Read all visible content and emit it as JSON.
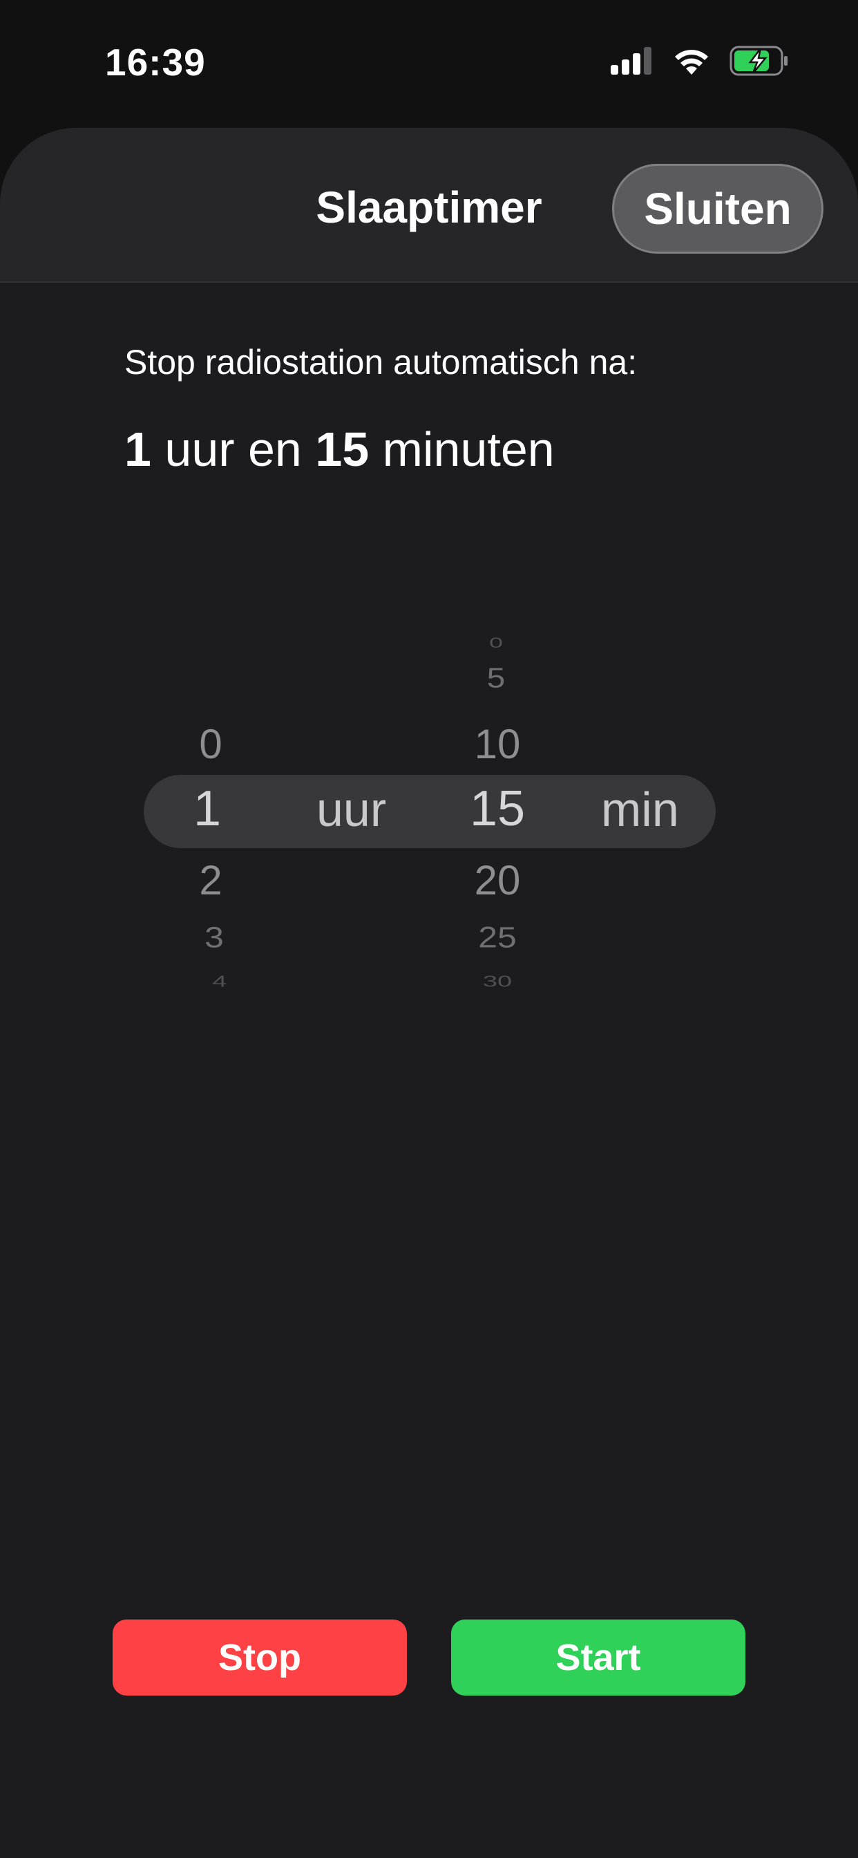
{
  "status_bar": {
    "time": "16:39",
    "icons": [
      "cellular-signal-icon",
      "wifi-icon",
      "battery-charging-icon"
    ]
  },
  "sheet": {
    "title": "Slaaptimer",
    "close_label": "Sluiten"
  },
  "description": "Stop radiostation automatisch na:",
  "duration": {
    "hours": "1",
    "hours_text": " uur en ",
    "minutes": "15",
    "minutes_text": " minuten"
  },
  "picker": {
    "hours": {
      "above": [
        "0"
      ],
      "selected": "1",
      "below": [
        "2",
        "3",
        "4"
      ],
      "unit": "uur"
    },
    "minutes": {
      "above": [
        "0",
        "5",
        "10"
      ],
      "selected": "15",
      "below": [
        "20",
        "25",
        "30"
      ],
      "unit": "min"
    }
  },
  "buttons": {
    "stop_label": "Stop",
    "start_label": "Start"
  },
  "colors": {
    "background": "#111111",
    "sheet": "#1c1c1e",
    "stop": "#fe4144",
    "start": "#30d158",
    "battery": "#30d158"
  }
}
